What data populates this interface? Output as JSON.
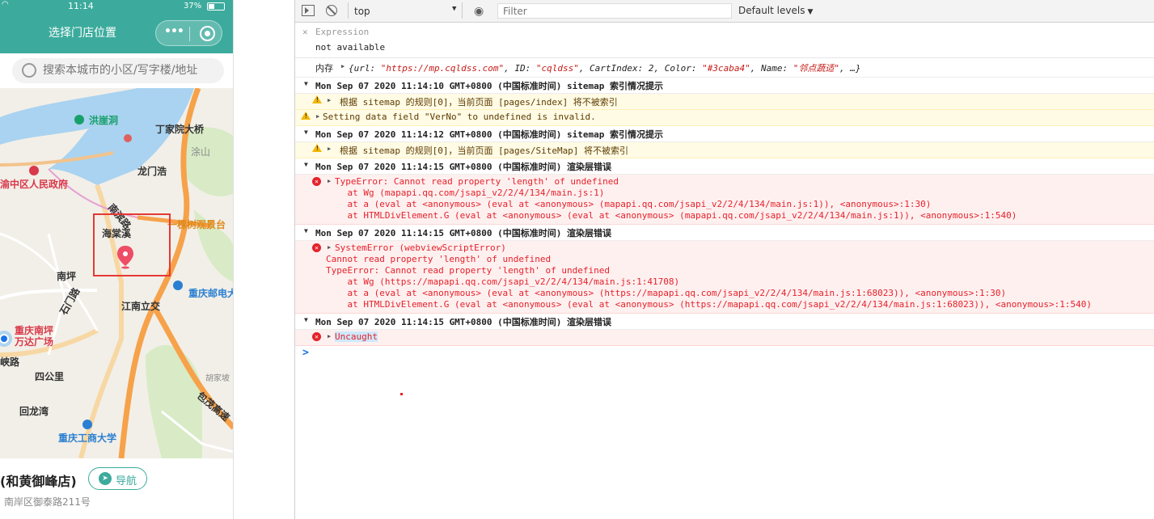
{
  "phone": {
    "status": {
      "time": "11:14",
      "battery": "37%"
    },
    "nav": {
      "title": "选择门店位置"
    },
    "search": {
      "placeholder": "搜索本城市的小区/写字楼/地址"
    },
    "map": {
      "labels": [
        {
          "text": "洪崖洞",
          "style": "green"
        },
        {
          "text": "丁家院大桥",
          "style": "bold"
        },
        {
          "text": "涂山",
          "style": "gray"
        },
        {
          "text": "龙门浩",
          "style": "bold"
        },
        {
          "text": "渝中区人民政府",
          "style": "red"
        },
        {
          "text": "海棠溪",
          "style": "bold"
        },
        {
          "text": "一棵树观景台",
          "style": "orange"
        },
        {
          "text": "南坪",
          "style": "bold"
        },
        {
          "text": "重庆邮电大",
          "style": "blue"
        },
        {
          "text": "江南立交",
          "style": "bold"
        },
        {
          "text": "重庆南坪",
          "style": "red"
        },
        {
          "text": "万达广场",
          "style": "red"
        },
        {
          "text": "四公里",
          "style": "bold"
        },
        {
          "text": "回龙湾",
          "style": "bold"
        },
        {
          "text": "重庆工商大学",
          "style": "blue"
        },
        {
          "text": "胡家坡",
          "style": "gray"
        },
        {
          "text": "包茂高速",
          "style": "bold"
        },
        {
          "text": "峡路",
          "style": "bold"
        },
        {
          "text": "南滨路",
          "style": "bold"
        },
        {
          "text": "石门路",
          "style": "bold"
        }
      ]
    },
    "store": {
      "name": "(和黄御峰店)",
      "nav_label": "导航",
      "address": "南岸区御泰路211号"
    }
  },
  "devtools": {
    "toolbar": {
      "context": "top",
      "filter_placeholder": "Filter",
      "levels": "Default levels"
    },
    "expression": {
      "name": "Expression",
      "value": "not available"
    },
    "memory": {
      "label": "内存",
      "obj_prefix": "{url: ",
      "url": "\"https://mp.cqldss.com\"",
      "id_key": ", ID: ",
      "id": "\"cqldss\"",
      "cart_key": ", CartIndex: 2, Color: ",
      "color": "\"#3caba4\"",
      "name_key": ", Name: ",
      "name": "\"邻点蔬适\"",
      "obj_suffix": ", …}"
    },
    "entries": [
      {
        "type": "group",
        "text": "Mon Sep 07 2020 11:14:10 GMT+0800 (中国标准时间) sitemap 索引情况提示"
      },
      {
        "type": "warn",
        "text": "根据 sitemap 的规则[0]，当前页面 [pages/index] 将不被索引"
      },
      {
        "type": "warn2",
        "text": "Setting data field \"VerNo\" to undefined is invalid."
      },
      {
        "type": "group",
        "text": "Mon Sep 07 2020 11:14:12 GMT+0800 (中国标准时间) sitemap 索引情况提示"
      },
      {
        "type": "warn",
        "text": "根据 sitemap 的规则[0]，当前页面 [pages/SiteMap] 将不被索引"
      },
      {
        "type": "group",
        "text": "Mon Sep 07 2020 11:14:15 GMT+0800 (中国标准时间) 渲染层错误"
      },
      {
        "type": "err",
        "text": "TypeError: Cannot read property 'length' of undefined",
        "stack": [
          "    at Wg (mapapi.qq.com/jsapi_v2/2/4/134/main.js:1)",
          "    at a (eval at <anonymous> (eval at <anonymous> (mapapi.qq.com/jsapi_v2/2/4/134/main.js:1)), <anonymous>:1:30)",
          "    at HTMLDivElement.G (eval at <anonymous> (eval at <anonymous> (mapapi.qq.com/jsapi_v2/2/4/134/main.js:1)), <anonymous>:1:540)"
        ]
      },
      {
        "type": "group",
        "text": "Mon Sep 07 2020 11:14:15 GMT+0800 (中国标准时间) 渲染层错误"
      },
      {
        "type": "err",
        "text": "SystemError (webviewScriptError)",
        "stack": [
          "Cannot read property 'length' of undefined",
          "TypeError: Cannot read property 'length' of undefined",
          "    at Wg (https://mapapi.qq.com/jsapi_v2/2/4/134/main.js:1:41708)",
          "    at a (eval at <anonymous> (eval at <anonymous> (https://mapapi.qq.com/jsapi_v2/2/4/134/main.js:1:68023)), <anonymous>:1:30)",
          "    at HTMLDivElement.G (eval at <anonymous> (eval at <anonymous> (https://mapapi.qq.com/jsapi_v2/2/4/134/main.js:1:68023)), <anonymous>:1:540)"
        ]
      },
      {
        "type": "group",
        "text": "Mon Sep 07 2020 11:14:15 GMT+0800 (中国标准时间) 渲染层错误"
      },
      {
        "type": "err",
        "text": "Uncaught"
      }
    ],
    "prompt": ">"
  },
  "colors": {
    "accent": "#3cab9d",
    "error": "#e4222a",
    "warn_bg": "#fffbe5",
    "error_bg": "#fff0f0"
  }
}
